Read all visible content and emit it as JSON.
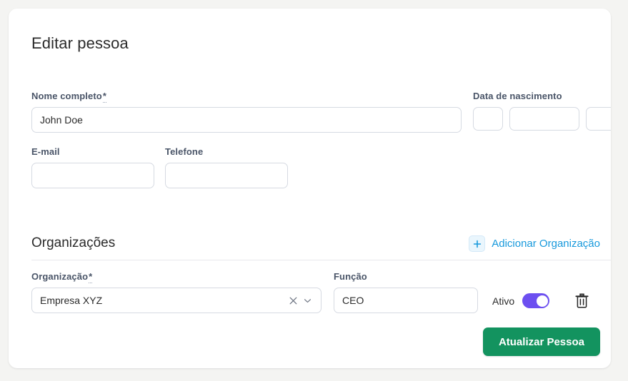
{
  "page": {
    "title": "Editar pessoa",
    "background_color": "#f4f4f2",
    "card_color": "#ffffff"
  },
  "person_form": {
    "name": {
      "label": "Nome completo",
      "required_marker": "*",
      "value": "John Doe",
      "placeholder": ""
    },
    "birth_date": {
      "label": "Data de nascimento",
      "day": {
        "value": "",
        "placeholder": ""
      },
      "month": {
        "value": "",
        "placeholder": ""
      },
      "year": {
        "value": "",
        "placeholder": ""
      }
    },
    "email": {
      "label": "E-mail",
      "value": "",
      "placeholder": ""
    },
    "phone": {
      "label": "Telefone",
      "value": "",
      "placeholder": ""
    }
  },
  "organizations_section": {
    "title": "Organizações",
    "add_button": {
      "label": "Adicionar Organização",
      "icon": "plus-icon",
      "color": "#1799dc"
    },
    "row": {
      "organization": {
        "label": "Organização",
        "required_marker": "*",
        "value": "Empresa XYZ",
        "clear_icon": "close-icon",
        "dropdown_icon": "chevron-down-icon"
      },
      "role": {
        "label": "Função",
        "value": "CEO",
        "placeholder": ""
      },
      "active": {
        "label": "Ativo",
        "state": "on",
        "color": "#6c4ff0"
      },
      "delete_icon": "trash-icon"
    }
  },
  "footer": {
    "submit_label": "Atualizar Pessoa",
    "submit_color": "#13935f"
  }
}
